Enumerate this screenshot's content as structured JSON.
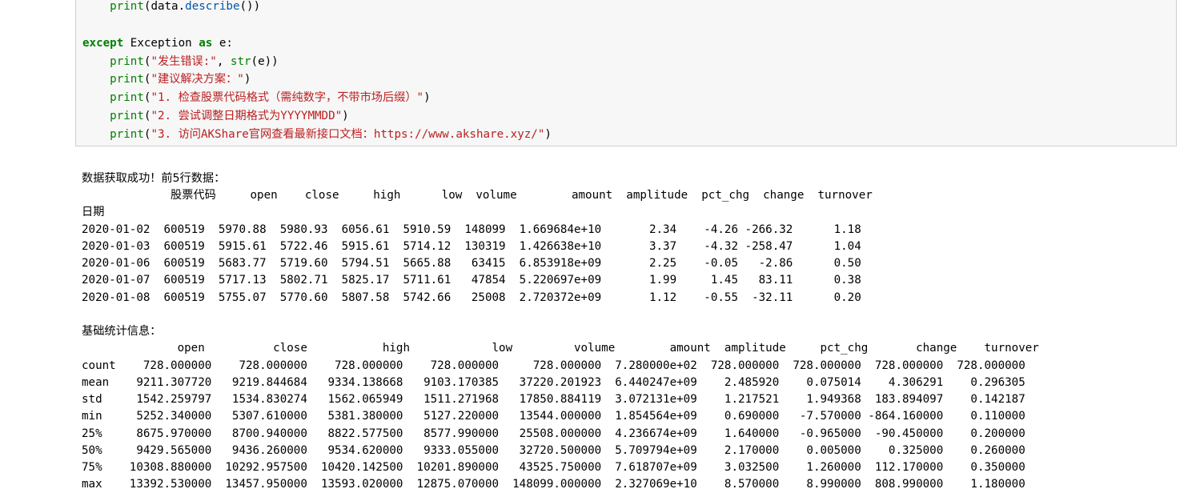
{
  "code": {
    "line1": {
      "indent": "    ",
      "fn": "print",
      "open": "(",
      "obj": "data",
      "dot": ".",
      "method": "describe",
      "close": "())"
    },
    "line3": {
      "kw": "except",
      "rest": " Exception ",
      "as": "as",
      "var": " e:"
    },
    "line4": {
      "indent": "    ",
      "fn": "print",
      "p1": "(",
      "str": "\"发生错误:\"",
      "mid": ", ",
      "fn2": "str",
      "tail": "(e))"
    },
    "line5": {
      "indent": "    ",
      "fn": "print",
      "p1": "(",
      "str": "\"建议解决方案：\"",
      "tail": ")"
    },
    "line6": {
      "indent": "    ",
      "fn": "print",
      "p1": "(",
      "str": "\"1. 检查股票代码格式（需纯数字，不带市场后缀）\"",
      "tail": ")"
    },
    "line7": {
      "indent": "    ",
      "fn": "print",
      "p1": "(",
      "str": "\"2. 尝试调整日期格式为YYYYMMDD\"",
      "tail": ")"
    },
    "line8": {
      "indent": "    ",
      "fn": "print",
      "p1": "(",
      "str": "\"3. 访问AKShare官网查看最新接口文档：https://www.akshare.xyz/\"",
      "tail": ")"
    }
  },
  "output": {
    "success_msg": "数据获取成功！前5行数据：",
    "head_header": "             股票代码     open    close     high      low  volume        amount  amplitude  pct_chg  change  turnover",
    "head_index_name": "日期",
    "head_rows": [
      "2020-01-02  600519  5970.88  5980.93  6056.61  5910.59  148099  1.669684e+10       2.34    -4.26 -266.32      1.18",
      "2020-01-03  600519  5915.61  5722.46  5915.61  5714.12  130319  1.426638e+10       3.37    -4.32 -258.47      1.04",
      "2020-01-06  600519  5683.77  5719.60  5794.51  5665.88   63415  6.853918e+09       2.25    -0.05   -2.86      0.50",
      "2020-01-07  600519  5717.13  5802.71  5825.17  5711.61   47854  5.220697e+09       1.99     1.45   83.11      0.38",
      "2020-01-08  600519  5755.07  5770.60  5807.58  5742.66   25008  2.720372e+09       1.12    -0.55  -32.11      0.20"
    ],
    "stats_title": "基础统计信息：",
    "stats_header": "              open          close           high            low         volume        amount  amplitude     pct_chg       change    turnover",
    "stats_rows": [
      "count    728.000000    728.000000    728.000000    728.000000     728.000000  7.280000e+02  728.000000  728.000000  728.000000  728.000000",
      "mean    9211.307720   9219.844684   9334.138668   9103.170385   37220.201923  6.440247e+09    2.485920    0.075014    4.306291    0.296305",
      "std     1542.259797   1534.830274   1562.065949   1511.271968   17850.884119  3.072131e+09    1.217521    1.949368  183.894097    0.142187",
      "min     5252.340000   5307.610000   5381.380000   5127.220000   13544.000000  1.854564e+09    0.690000   -7.570000 -864.160000    0.110000",
      "25%     8675.970000   8700.940000   8822.577500   8577.990000   25508.000000  4.236674e+09    1.640000   -0.965000  -90.450000    0.200000",
      "50%     9429.565000   9436.260000   9534.620000   9333.055000   32720.500000  5.709794e+09    2.170000    0.005000    0.325000    0.260000",
      "75%    10308.880000  10292.957500  10420.142500  10201.890000   43525.750000  7.618707e+09    3.032500    1.260000  112.170000    0.350000",
      "max    13392.530000  13457.950000  13593.020000  12875.070000  148099.000000  2.327069e+10    8.570000    8.990000  808.990000    1.180000"
    ]
  }
}
